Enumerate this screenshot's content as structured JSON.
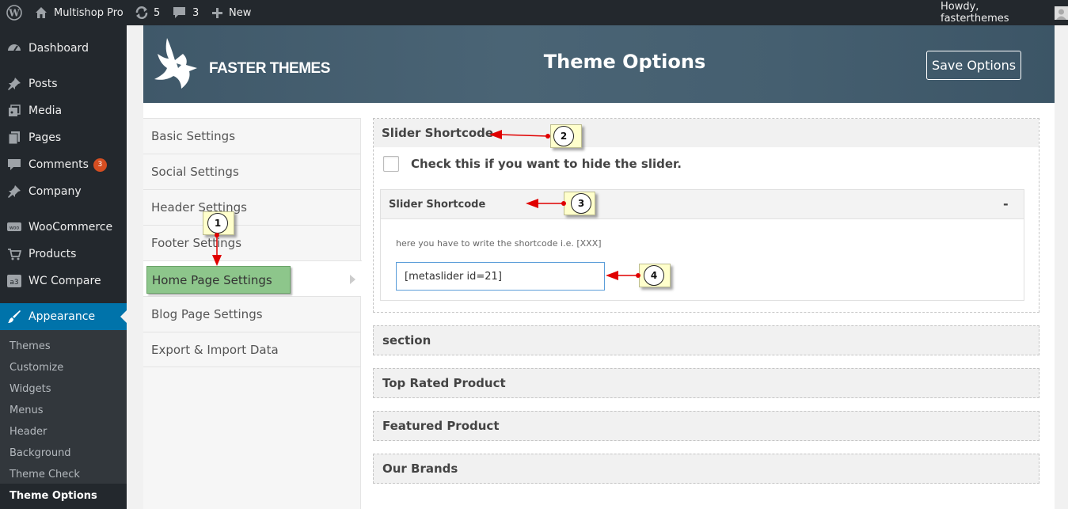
{
  "adminbar": {
    "site_name": "Multishop Pro",
    "updates_count": "5",
    "comments_count": "3",
    "new_label": "New",
    "howdy": "Howdy, fasterthemes"
  },
  "sidebar": {
    "items": [
      {
        "label": "Dashboard",
        "icon": "dashboard-icon"
      },
      {
        "label": "Posts",
        "icon": "pin-icon"
      },
      {
        "label": "Media",
        "icon": "media-icon"
      },
      {
        "label": "Pages",
        "icon": "pages-icon"
      },
      {
        "label": "Comments",
        "icon": "comment-icon",
        "badge": "3"
      },
      {
        "label": "Company",
        "icon": "pin-icon"
      },
      {
        "label": "WooCommerce",
        "icon": "woo-icon"
      },
      {
        "label": "Products",
        "icon": "cart-icon"
      },
      {
        "label": "WC Compare",
        "icon": "a3-icon"
      },
      {
        "label": "Appearance",
        "icon": "brush-icon"
      }
    ],
    "submenu": [
      "Themes",
      "Customize",
      "Widgets",
      "Menus",
      "Header",
      "Background",
      "Theme Check",
      "Theme Options"
    ]
  },
  "header": {
    "brand": "FASTER THEMES",
    "title": "Theme Options",
    "save_label": "Save Options"
  },
  "nav": {
    "items": [
      "Basic Settings",
      "Social Settings",
      "Header Settings",
      "Footer Settings",
      "Home Page Settings",
      "Blog Page Settings",
      "Export & Import Data"
    ]
  },
  "main": {
    "slider_section_title": "Slider Shortcode",
    "hide_slider_label": "Check this if you want to hide the slider.",
    "inner_title": "Slider Shortcode",
    "inner_toggle": "-",
    "help_text": "here you have to write the shortcode i.e. [XXX]",
    "shortcode_value": "[metaslider id=21]",
    "sections": [
      "section",
      "Top Rated Product",
      "Featured Product",
      "Our Brands"
    ]
  },
  "callouts": [
    "1",
    "2",
    "3",
    "4"
  ],
  "colors": {
    "admin_bg": "#23282d",
    "active_blue": "#0073aa",
    "highlight_green": "#8dc68b",
    "callout_bg": "#ffffcc",
    "arrow_red": "#e00000"
  }
}
